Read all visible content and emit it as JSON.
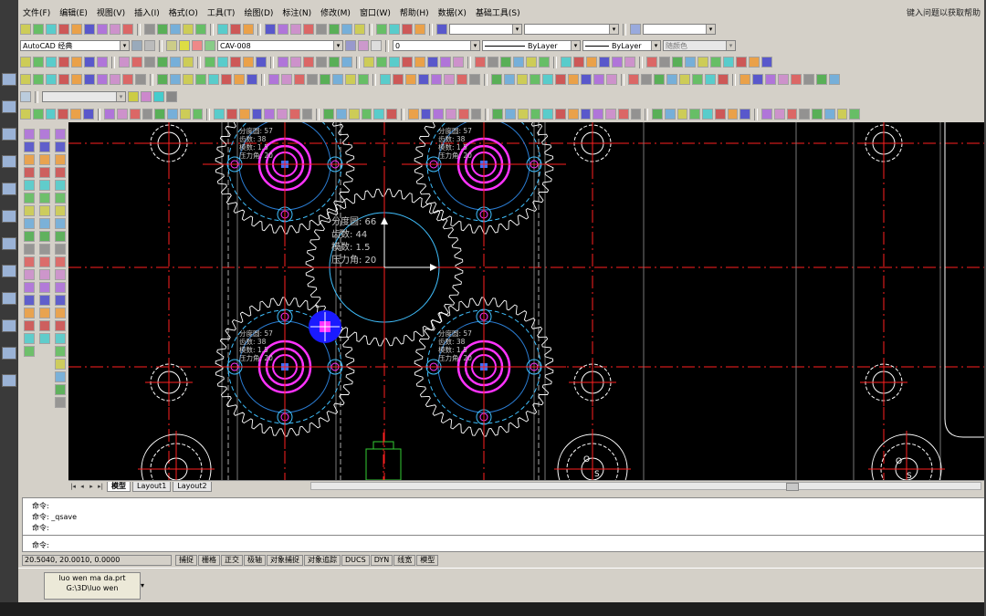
{
  "window": {
    "help_text": "键入问题以获取帮助"
  },
  "menu": {
    "items": [
      "文件(F)",
      "编辑(E)",
      "视图(V)",
      "插入(I)",
      "格式(O)",
      "工具(T)",
      "绘图(D)",
      "标注(N)",
      "修改(M)",
      "窗口(W)",
      "帮助(H)",
      "数据(X)",
      "基础工具(S)"
    ]
  },
  "toolbar": {
    "workspace": "AutoCAD 经典",
    "textstyle": "CAV-008",
    "layer": "0",
    "linetype_label": "ByLayer",
    "lineweight_label": "ByLayer",
    "plotstyle": "随颜色"
  },
  "colors": {
    "canvas": "#000000",
    "gear_outline": "#ffffff",
    "hub": "#ff33ff",
    "pitch": "#40c0ff",
    "center": "#ff2020",
    "text": "#c8c8c8",
    "highlight": "#1a1aff"
  },
  "drawing": {
    "center_gear_labels": [
      "分度圆: 66",
      "齿数: 44",
      "模数: 1.5",
      "压力角: 20"
    ],
    "gear_labels": [
      "分度圆: 57",
      "齿数: 38",
      "模数: 1.5",
      "压力角: 20"
    ],
    "marks": [
      "O",
      "S"
    ]
  },
  "tabs": {
    "model": "模型",
    "layout1": "Layout1",
    "layout2": "Layout2"
  },
  "command": {
    "line1": "命令:",
    "line2": "命令: _qsave",
    "line3": "命令:",
    "prompt": "命令:"
  },
  "status": {
    "coords": "20.5040, 20.0010, 0.0000",
    "snap": "捕捉",
    "grid": "栅格",
    "ortho": "正交",
    "polar": "极轴",
    "osnap": "对象捕捉",
    "otrack": "对象追踪",
    "ducs": "DUCS",
    "dyn": "DYN",
    "lwt": "线宽",
    "model": "模型"
  },
  "taskbar": {
    "file_line1": "luo wen ma da.prt",
    "file_line2": "G:\\3D\\luo wen"
  }
}
